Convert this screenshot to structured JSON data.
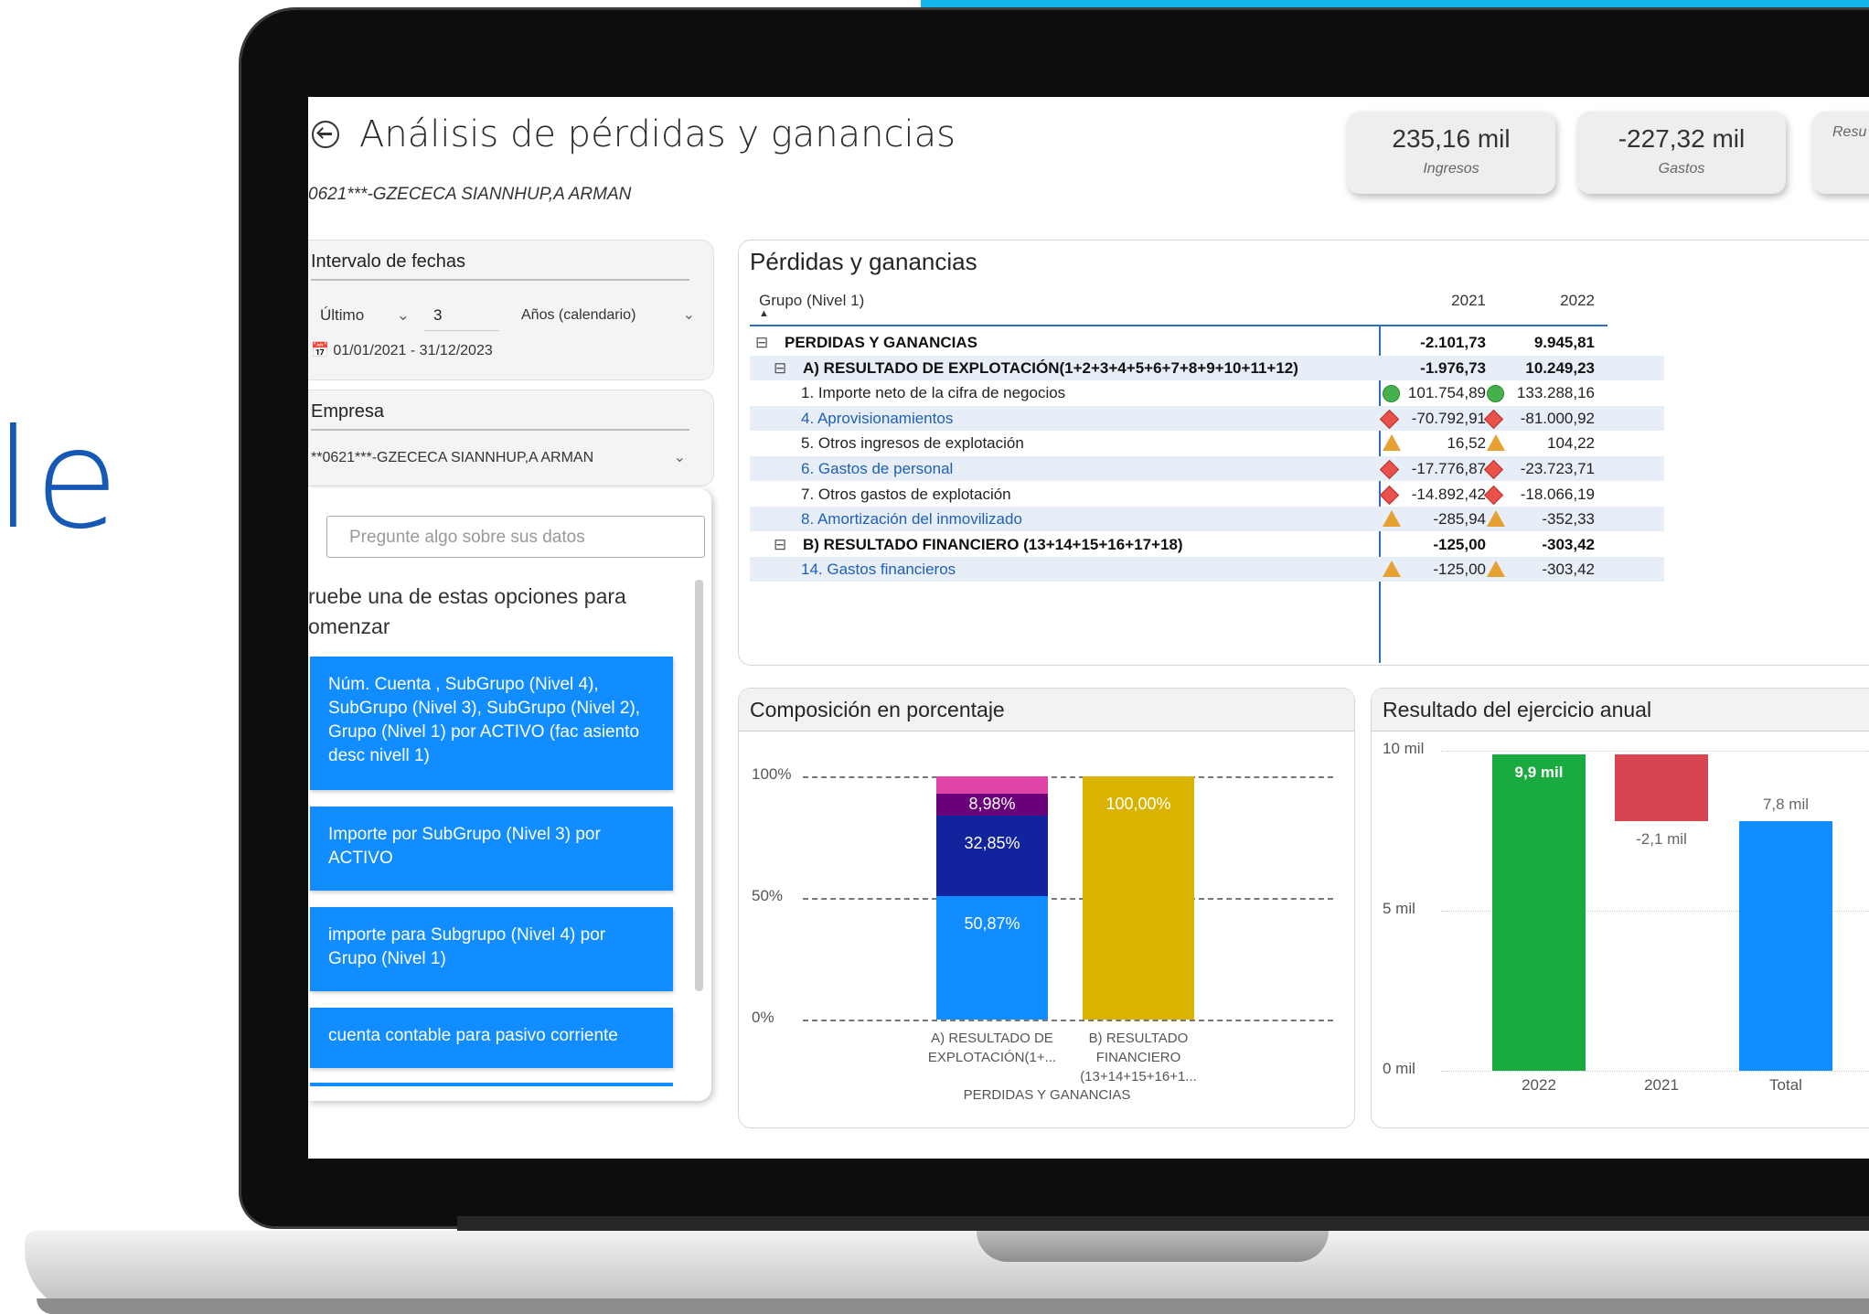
{
  "background_text": "le",
  "header": {
    "title": "Análisis de pérdidas y ganancias",
    "company": "0621***-GZECECA SIANNHUP,A ARMAN"
  },
  "kpis": [
    {
      "value": "235,16 mil",
      "label": "Ingresos"
    },
    {
      "value": "-227,32 mil",
      "label": "Gastos"
    },
    {
      "value": "",
      "label": "Resu"
    }
  ],
  "date_slicer": {
    "title": "Intervalo de fechas",
    "mode": "Último",
    "count": "3",
    "unit": "Años (calendario)",
    "range": "01/01/2021 - 31/12/2023"
  },
  "company_slicer": {
    "title": "Empresa",
    "value": "**0621***-GZECECA SIANNHUP,A ARMAN"
  },
  "qa": {
    "placeholder": "Pregunte algo sobre sus datos",
    "hint": "ruebe una de estas opciones para omenzar",
    "suggestions": [
      "Núm. Cuenta , SubGrupo (Nivel 4), SubGrupo (Nivel 3), SubGrupo (Nivel 2), Grupo (Nivel 1) por ACTIVO (fac asiento desc nivell 1)",
      "Importe por SubGrupo (Nivel 3) por ACTIVO",
      "importe para Subgrupo (Nivel 4) por Grupo (Nivel 1)",
      "cuenta contable para pasivo corriente"
    ]
  },
  "matrix": {
    "title": "Pérdidas y ganancias",
    "group_header": "Grupo (Nivel 1)",
    "years": [
      "2021",
      "2022"
    ],
    "rows": [
      {
        "label": "PERDIDAS Y GANANCIAS",
        "v2021": "-2.101,73",
        "v2022": "9.945,81",
        "style": "bold",
        "level": 0,
        "icon": null
      },
      {
        "label": "A) RESULTADO DE EXPLOTACIÓN(1+2+3+4+5+6+7+8+9+10+11+12)",
        "v2021": "-1.976,73",
        "v2022": "10.249,23",
        "style": "bold",
        "level": 1,
        "icon": null
      },
      {
        "label": "1. Importe neto de la cifra de negocios",
        "v2021": "101.754,89",
        "v2022": "133.288,16",
        "style": "normal",
        "level": 2,
        "icon": "circle"
      },
      {
        "label": "4. Aprovisionamientos",
        "v2021": "-70.792,91",
        "v2022": "-81.000,92",
        "style": "link",
        "level": 2,
        "icon": "diamond"
      },
      {
        "label": "5. Otros ingresos de explotación",
        "v2021": "16,52",
        "v2022": "104,22",
        "style": "normal",
        "level": 2,
        "icon": "triangle"
      },
      {
        "label": "6. Gastos de personal",
        "v2021": "-17.776,87",
        "v2022": "-23.723,71",
        "style": "link",
        "level": 2,
        "icon": "diamond"
      },
      {
        "label": "7. Otros gastos de explotación",
        "v2021": "-14.892,42",
        "v2022": "-18.066,19",
        "style": "normal",
        "level": 2,
        "icon": "diamond"
      },
      {
        "label": "8. Amortización del inmovilizado",
        "v2021": "-285,94",
        "v2022": "-352,33",
        "style": "link",
        "level": 2,
        "icon": "triangle"
      },
      {
        "label": "B) RESULTADO FINANCIERO (13+14+15+16+17+18)",
        "v2021": "-125,00",
        "v2022": "-303,42",
        "style": "bold",
        "level": 1,
        "icon": null
      },
      {
        "label": "14. Gastos financieros",
        "v2021": "-125,00",
        "v2022": "-303,42",
        "style": "link",
        "level": 2,
        "icon": "triangle"
      }
    ]
  },
  "chart_data": [
    {
      "type": "bar",
      "stacked": true,
      "title": "Composición en porcentaje",
      "categories": [
        "A) RESULTADO DE EXPLOTACIÓN(1+...",
        "B) RESULTADO FINANCIERO (13+14+15+16+1..."
      ],
      "group_label": "PERDIDAS Y GANANCIAS",
      "yticks": [
        "100%",
        "50%",
        "0%"
      ],
      "ylim": [
        0,
        100
      ],
      "series": [
        {
          "values": [
            50.87,
            0
          ],
          "color": "#118dff",
          "labels": [
            "50,87%",
            ""
          ]
        },
        {
          "values": [
            32.85,
            0
          ],
          "color": "#12239e",
          "labels": [
            "32,85%",
            ""
          ]
        },
        {
          "values": [
            8.98,
            0
          ],
          "color": "#6b007b",
          "labels": [
            "8,98%",
            ""
          ]
        },
        {
          "values": [
            7.3,
            0
          ],
          "color": "#e044a7",
          "labels": [
            "",
            ""
          ]
        },
        {
          "values": [
            0,
            100
          ],
          "color": "#d9b300",
          "labels": [
            "",
            "100,00%"
          ]
        }
      ],
      "grid": true
    },
    {
      "type": "bar",
      "waterfall": true,
      "title": "Resultado del ejercicio anual",
      "categories": [
        "2022",
        "2021",
        "Total"
      ],
      "values": [
        9.9,
        -2.1,
        7.8
      ],
      "value_labels": [
        "9,9 mil",
        "-2,1 mil",
        "7,8 mil"
      ],
      "colors": [
        "#1aab40",
        "#d64550",
        "#118dff"
      ],
      "yticks": [
        "10 mil",
        "5 mil",
        "0 mil"
      ],
      "ylim": [
        0,
        10
      ],
      "unit": "mil"
    }
  ]
}
